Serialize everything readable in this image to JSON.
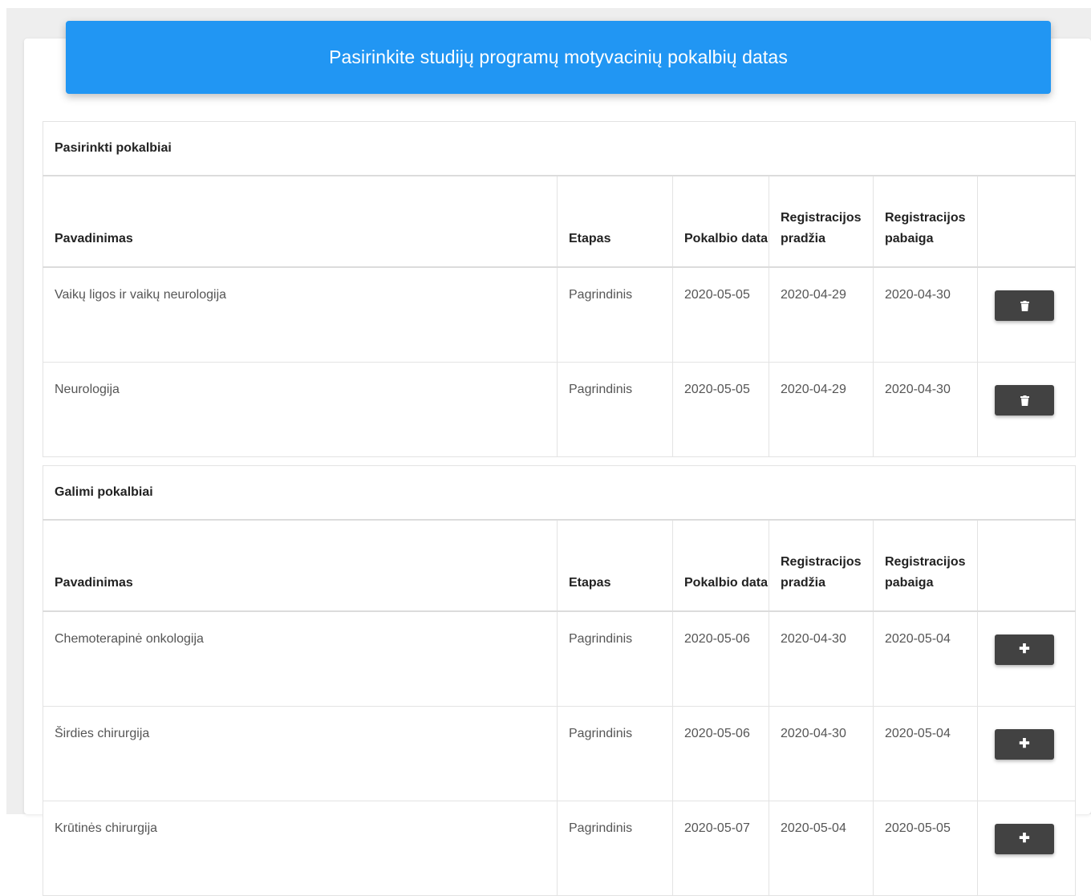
{
  "header": {
    "title": "Pasirinkite studijų programų motyvacinių pokalbių datas"
  },
  "selected": {
    "caption": "Pasirinkti pokalbiai",
    "columns": [
      "Pavadinimas",
      "Etapas",
      "Pokalbio data",
      "Registracijos pradžia",
      "Registracijos pabaiga"
    ],
    "rows": [
      {
        "name": "Vaikų ligos ir vaikų neurologija",
        "stage": "Pagrindinis",
        "date": "2020-05-05",
        "reg_start": "2020-04-29",
        "reg_end": "2020-04-30",
        "action_icon": "trash-icon"
      },
      {
        "name": "Neurologija",
        "stage": "Pagrindinis",
        "date": "2020-05-05",
        "reg_start": "2020-04-29",
        "reg_end": "2020-04-30",
        "action_icon": "trash-icon"
      }
    ]
  },
  "available": {
    "caption": "Galimi pokalbiai",
    "columns": [
      "Pavadinimas",
      "Etapas",
      "Pokalbio data",
      "Registracijos pradžia",
      "Registracijos pabaiga"
    ],
    "rows": [
      {
        "name": "Chemoterapinė onkologija",
        "stage": "Pagrindinis",
        "date": "2020-05-06",
        "reg_start": "2020-04-30",
        "reg_end": "2020-05-04",
        "action_icon": "plus-icon"
      },
      {
        "name": "Širdies chirurgija",
        "stage": "Pagrindinis",
        "date": "2020-05-06",
        "reg_start": "2020-04-30",
        "reg_end": "2020-05-04",
        "action_icon": "plus-icon"
      },
      {
        "name": "Krūtinės chirurgija",
        "stage": "Pagrindinis",
        "date": "2020-05-07",
        "reg_start": "2020-05-04",
        "reg_end": "2020-05-05",
        "action_icon": "plus-icon"
      }
    ]
  },
  "colors": {
    "header_bg": "#2196f3",
    "button_bg": "#424242",
    "page_bg": "#eeeeee"
  }
}
